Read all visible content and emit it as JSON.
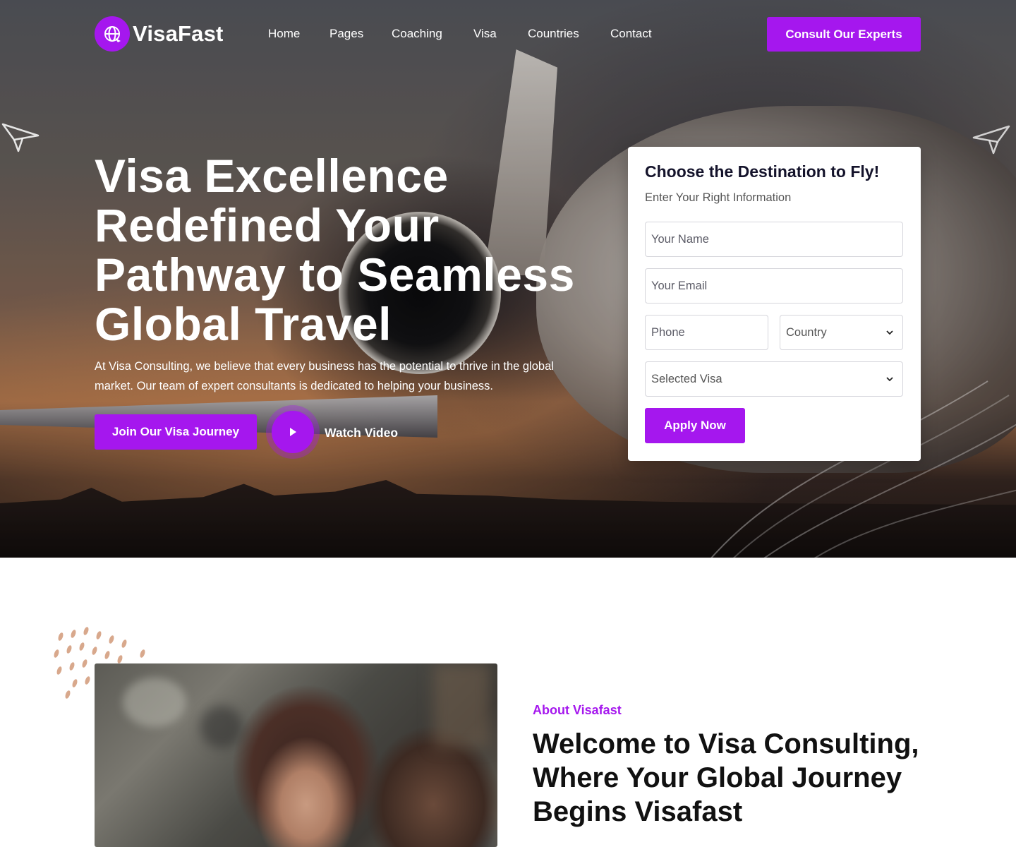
{
  "brand": {
    "name": "VisaFast",
    "icon": "globe-plane-icon",
    "accent": "#a517ee"
  },
  "nav": {
    "items": [
      {
        "label": "Home"
      },
      {
        "label": "Pages"
      },
      {
        "label": "Coaching"
      },
      {
        "label": "Visa"
      },
      {
        "label": "Countries"
      },
      {
        "label": "Contact"
      }
    ],
    "cta_label": "Consult Our Experts"
  },
  "hero": {
    "title": "Visa Excellence Redefined Your Pathway to Seamless Global Travel",
    "description": "At Visa Consulting, we believe that every business has the potential to thrive in the global market. Our team of expert consultants is dedicated to helping your business.",
    "primary_button": "Join Our Visa Journey",
    "video_label": "Watch Video"
  },
  "form": {
    "title": "Choose the Destination to Fly!",
    "subtitle": "Enter Your Right Information",
    "name_placeholder": "Your Name",
    "email_placeholder": "Your Email",
    "phone_placeholder": "Phone",
    "country_value": "Country",
    "visa_value": "Selected Visa",
    "submit_label": "Apply Now"
  },
  "about": {
    "kicker": "About Visafast",
    "title": "Welcome to Visa Consulting, Where Your Global Journey Begins Visafast"
  }
}
